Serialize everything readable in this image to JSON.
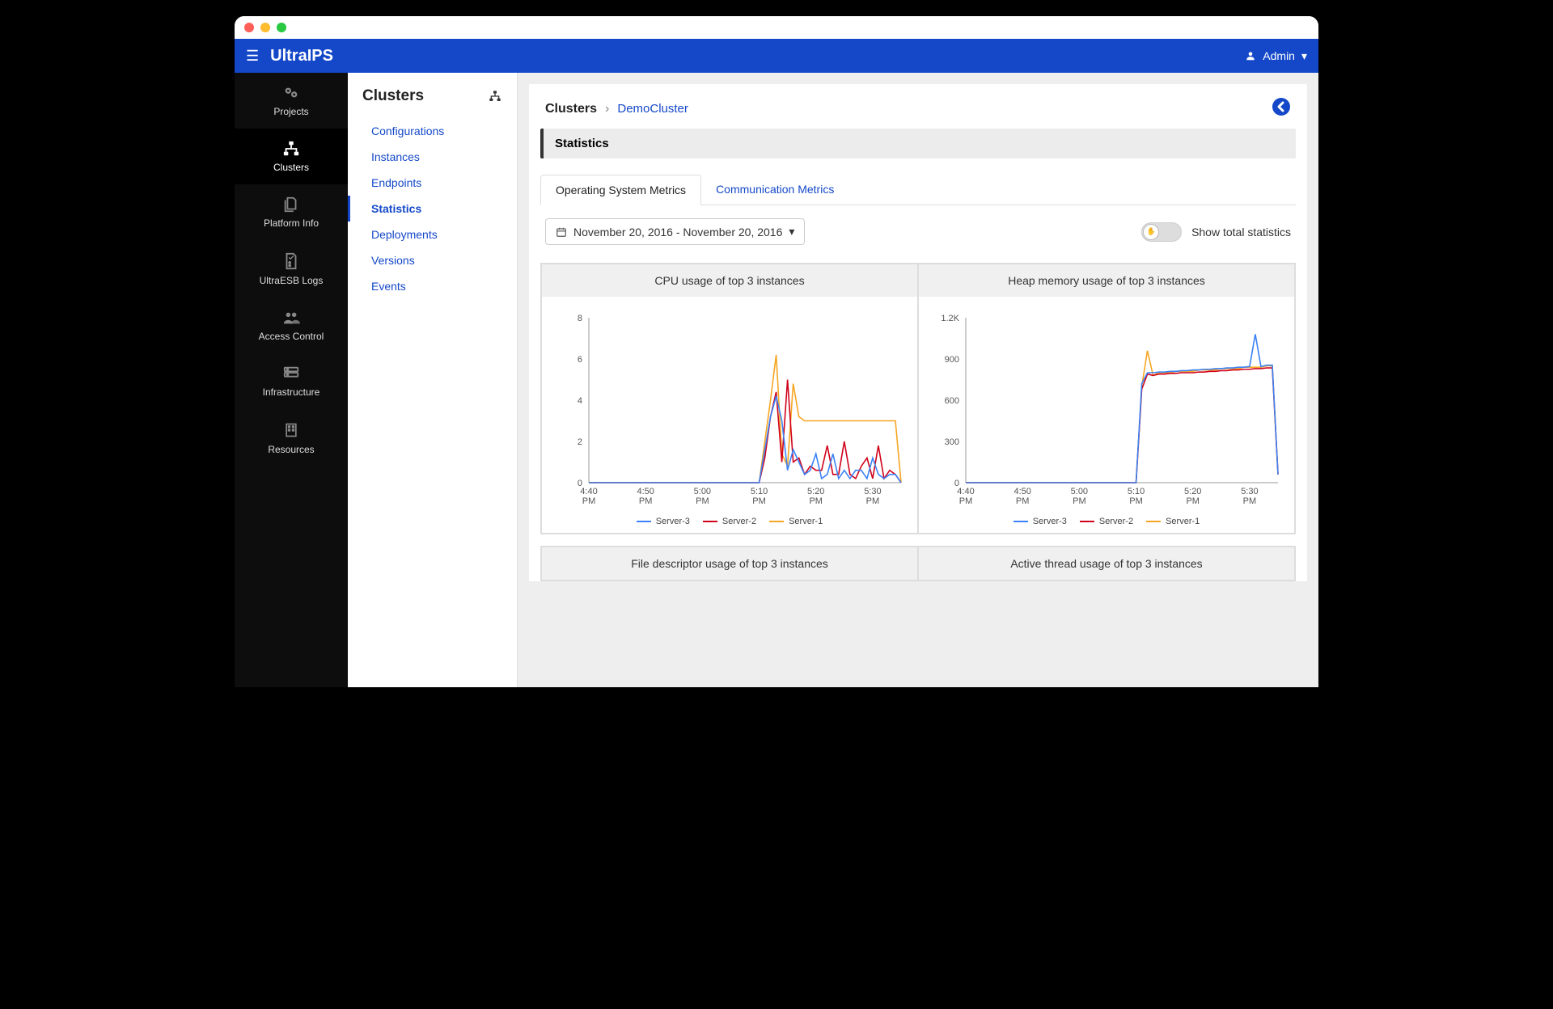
{
  "app": {
    "title": "UltraIPS",
    "user_label": "Admin"
  },
  "sidebar": {
    "items": [
      {
        "label": "Projects"
      },
      {
        "label": "Clusters"
      },
      {
        "label": "Platform Info"
      },
      {
        "label": "UltraESB Logs"
      },
      {
        "label": "Access Control"
      },
      {
        "label": "Infrastructure"
      },
      {
        "label": "Resources"
      }
    ]
  },
  "subpanel": {
    "title": "Clusters",
    "items": [
      {
        "label": "Configurations"
      },
      {
        "label": "Instances"
      },
      {
        "label": "Endpoints"
      },
      {
        "label": "Statistics"
      },
      {
        "label": "Deployments"
      },
      {
        "label": "Versions"
      },
      {
        "label": "Events"
      }
    ]
  },
  "breadcrumb": {
    "root": "Clusters",
    "sep": "›",
    "leaf": "DemoCluster"
  },
  "section": {
    "title": "Statistics"
  },
  "tabs": {
    "items": [
      {
        "label": "Operating System Metrics"
      },
      {
        "label": "Communication Metrics"
      }
    ]
  },
  "datepicker": {
    "label": "November 20, 2016 - November 20, 2016"
  },
  "toggle": {
    "label": "Show total statistics"
  },
  "charts": {
    "titles": [
      "CPU usage of top 3 instances",
      "Heap memory usage of top 3 instances",
      "File descriptor usage of top 3 instances",
      "Active thread usage of top 3 instances"
    ],
    "colors": {
      "s1": "#f6a623",
      "s2": "#d0021b",
      "s3": "#3b82f6"
    },
    "legend": [
      "Server-3",
      "Server-2",
      "Server-1"
    ]
  },
  "chart_data": [
    {
      "type": "line",
      "title": "CPU usage of top 3 instances",
      "x_ticks": [
        "4:40 PM",
        "4:50 PM",
        "5:00 PM",
        "5:10 PM",
        "5:20 PM",
        "5:30 PM"
      ],
      "y_ticks": [
        0,
        2,
        4,
        6,
        8
      ],
      "ylim": [
        0,
        8
      ],
      "xlim": [
        "4:40 PM",
        "5:35 PM"
      ],
      "series_x_minutes": [
        280,
        281,
        282,
        283,
        284,
        285,
        286,
        287,
        288,
        289,
        290,
        291,
        292,
        293,
        294,
        295,
        296,
        297,
        298,
        299,
        300,
        301,
        302,
        303,
        304,
        305,
        306,
        307,
        308,
        309,
        310,
        311,
        312,
        313,
        314,
        315,
        316,
        317,
        318,
        319,
        320,
        321,
        322,
        323,
        324,
        325,
        326,
        327,
        328,
        329,
        330,
        331,
        332,
        333,
        334,
        335
      ],
      "series": [
        {
          "name": "Server-1",
          "color": "#f6a623",
          "values": [
            0,
            0,
            0,
            0,
            0,
            0,
            0,
            0,
            0,
            0,
            0,
            0,
            0,
            0,
            0,
            0,
            0,
            0,
            0,
            0,
            0,
            0,
            0,
            0,
            0,
            0,
            0,
            0,
            0,
            0,
            0,
            2.0,
            4.0,
            6.2,
            1.4,
            0.8,
            4.8,
            3.2,
            3.0,
            3.0,
            3.0,
            3.0,
            3.0,
            3.0,
            3.0,
            3.0,
            3.0,
            3.0,
            3.0,
            3.0,
            3.0,
            3.0,
            3.0,
            3.0,
            3.0,
            0
          ]
        },
        {
          "name": "Server-2",
          "color": "#d0021b",
          "values": [
            0,
            0,
            0,
            0,
            0,
            0,
            0,
            0,
            0,
            0,
            0,
            0,
            0,
            0,
            0,
            0,
            0,
            0,
            0,
            0,
            0,
            0,
            0,
            0,
            0,
            0,
            0,
            0,
            0,
            0,
            0,
            1.2,
            3.2,
            4.4,
            1.0,
            5.0,
            1.0,
            1.2,
            0.4,
            0.8,
            0.6,
            0.6,
            1.8,
            0.4,
            0.4,
            2.0,
            0.4,
            0.2,
            0.8,
            1.2,
            0.2,
            1.8,
            0.2,
            0.6,
            0.4,
            0
          ]
        },
        {
          "name": "Server-3",
          "color": "#3b82f6",
          "values": [
            0,
            0,
            0,
            0,
            0,
            0,
            0,
            0,
            0,
            0,
            0,
            0,
            0,
            0,
            0,
            0,
            0,
            0,
            0,
            0,
            0,
            0,
            0,
            0,
            0,
            0,
            0,
            0,
            0,
            0,
            0,
            1.6,
            3.2,
            4.2,
            3.0,
            0.6,
            1.6,
            1.0,
            0.4,
            0.6,
            1.4,
            0.2,
            0.4,
            1.4,
            0.2,
            0.6,
            0.2,
            0.6,
            0.6,
            0.2,
            1.2,
            0.4,
            0.2,
            0.4,
            0.4,
            0
          ]
        }
      ]
    },
    {
      "type": "line",
      "title": "Heap memory usage of top 3 instances",
      "x_ticks": [
        "4:40 PM",
        "4:50 PM",
        "5:00 PM",
        "5:10 PM",
        "5:20 PM",
        "5:30 PM"
      ],
      "y_ticks": [
        0,
        300,
        600,
        900,
        1200
      ],
      "y_tick_labels": [
        "0",
        "300",
        "600",
        "900",
        "1.2K"
      ],
      "ylim": [
        0,
        1200
      ],
      "xlim": [
        "4:40 PM",
        "5:35 PM"
      ],
      "series_x_minutes": [
        280,
        281,
        282,
        283,
        284,
        285,
        286,
        287,
        288,
        289,
        290,
        291,
        292,
        293,
        294,
        295,
        296,
        297,
        298,
        299,
        300,
        301,
        302,
        303,
        304,
        305,
        306,
        307,
        308,
        309,
        310,
        311,
        312,
        313,
        314,
        315,
        316,
        317,
        318,
        319,
        320,
        321,
        322,
        323,
        324,
        325,
        326,
        327,
        328,
        329,
        330,
        331,
        332,
        333,
        334,
        335
      ],
      "series": [
        {
          "name": "Server-1",
          "color": "#f6a623",
          "values": [
            0,
            0,
            0,
            0,
            0,
            0,
            0,
            0,
            0,
            0,
            0,
            0,
            0,
            0,
            0,
            0,
            0,
            0,
            0,
            0,
            0,
            0,
            0,
            0,
            0,
            0,
            0,
            0,
            0,
            0,
            0,
            700,
            960,
            780,
            800,
            800,
            800,
            810,
            810,
            810,
            810,
            820,
            820,
            820,
            820,
            830,
            830,
            830,
            830,
            840,
            840,
            840,
            840,
            850,
            850,
            60
          ]
        },
        {
          "name": "Server-2",
          "color": "#d0021b",
          "values": [
            0,
            0,
            0,
            0,
            0,
            0,
            0,
            0,
            0,
            0,
            0,
            0,
            0,
            0,
            0,
            0,
            0,
            0,
            0,
            0,
            0,
            0,
            0,
            0,
            0,
            0,
            0,
            0,
            0,
            0,
            0,
            680,
            790,
            780,
            790,
            790,
            795,
            795,
            800,
            800,
            800,
            805,
            805,
            810,
            810,
            815,
            815,
            820,
            820,
            825,
            825,
            830,
            830,
            835,
            835,
            60
          ]
        },
        {
          "name": "Server-3",
          "color": "#3b82f6",
          "values": [
            0,
            0,
            0,
            0,
            0,
            0,
            0,
            0,
            0,
            0,
            0,
            0,
            0,
            0,
            0,
            0,
            0,
            0,
            0,
            0,
            0,
            0,
            0,
            0,
            0,
            0,
            0,
            0,
            0,
            0,
            0,
            720,
            800,
            800,
            805,
            805,
            810,
            810,
            815,
            815,
            820,
            820,
            825,
            825,
            830,
            830,
            835,
            835,
            840,
            840,
            845,
            1080,
            845,
            855,
            855,
            60
          ]
        }
      ]
    }
  ]
}
